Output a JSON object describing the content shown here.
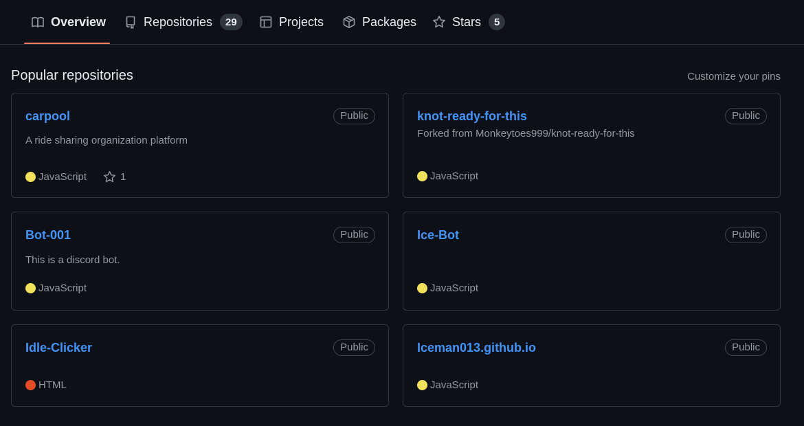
{
  "tabs": [
    {
      "label": "Overview",
      "icon": "book-icon",
      "active": true
    },
    {
      "label": "Repositories",
      "icon": "repo-icon",
      "count": "29"
    },
    {
      "label": "Projects",
      "icon": "table-icon"
    },
    {
      "label": "Packages",
      "icon": "package-icon"
    },
    {
      "label": "Stars",
      "icon": "star-icon",
      "count": "5"
    }
  ],
  "section_title": "Popular repositories",
  "customize_label": "Customize your pins",
  "colors": {
    "accent_tab": "#f78166",
    "link": "#4493f8",
    "javascript": "#f1e05a",
    "html": "#e34c26"
  },
  "repos": [
    {
      "name": "carpool",
      "visibility": "Public",
      "description": "A ride sharing organization platform",
      "language": "JavaScript",
      "stars": "1"
    },
    {
      "name": "knot-ready-for-this",
      "visibility": "Public",
      "forked_from": "Forked from Monkeytoes999/knot-ready-for-this",
      "language": "JavaScript"
    },
    {
      "name": "Bot-001",
      "visibility": "Public",
      "description": "This is a discord bot.",
      "language": "JavaScript"
    },
    {
      "name": "Ice-Bot",
      "visibility": "Public",
      "language": "JavaScript"
    },
    {
      "name": "Idle-Clicker",
      "visibility": "Public",
      "language": "HTML"
    },
    {
      "name": "Iceman013.github.io",
      "visibility": "Public",
      "language": "JavaScript"
    }
  ]
}
